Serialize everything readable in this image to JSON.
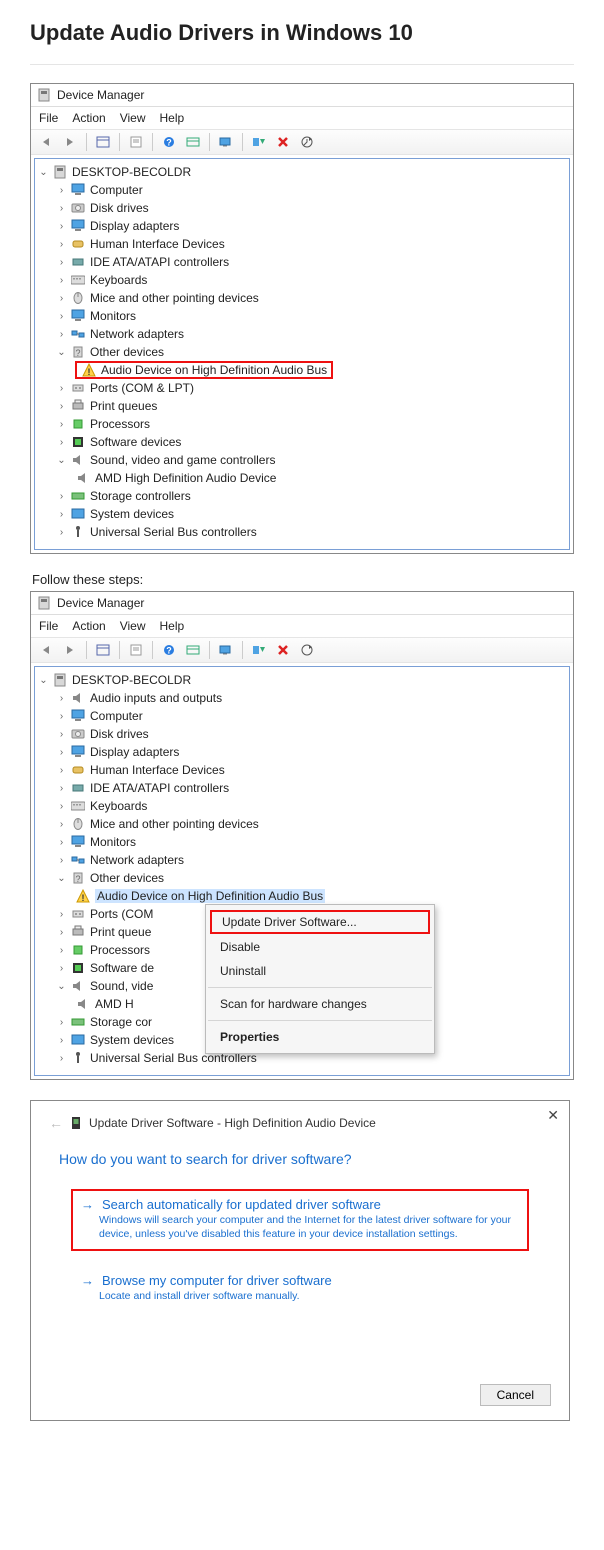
{
  "article": {
    "title": "Update Audio Drivers in Windows 10",
    "follow_steps": "Follow these steps:"
  },
  "dm": {
    "window_title": "Device Manager",
    "menus": [
      "File",
      "Action",
      "View",
      "Help"
    ],
    "root": "DESKTOP-BECOLDR",
    "categories_win1": [
      {
        "label": "Computer",
        "icon": "monitor"
      },
      {
        "label": "Disk drives",
        "icon": "disk"
      },
      {
        "label": "Display adapters",
        "icon": "monitor"
      },
      {
        "label": "Human Interface Devices",
        "icon": "hid"
      },
      {
        "label": "IDE ATA/ATAPI controllers",
        "icon": "ide"
      },
      {
        "label": "Keyboards",
        "icon": "keyboard"
      },
      {
        "label": "Mice and other pointing devices",
        "icon": "mouse"
      },
      {
        "label": "Monitors",
        "icon": "monitor"
      },
      {
        "label": "Network adapters",
        "icon": "net"
      }
    ],
    "other_devices_label": "Other devices",
    "other_devices_item": "Audio Device on High Definition Audio Bus",
    "after_other_win1": [
      {
        "label": "Ports (COM & LPT)",
        "icon": "port"
      },
      {
        "label": "Print queues",
        "icon": "printer"
      },
      {
        "label": "Processors",
        "icon": "cpu"
      },
      {
        "label": "Software devices",
        "icon": "sw"
      }
    ],
    "sound_label": "Sound, video and game controllers",
    "sound_child": "AMD High Definition Audio Device",
    "tail_win1": [
      {
        "label": "Storage controllers",
        "icon": "storage"
      },
      {
        "label": "System devices",
        "icon": "sys"
      },
      {
        "label": "Universal Serial Bus controllers",
        "icon": "usb"
      }
    ],
    "categories_win2_pre": [
      {
        "label": "Audio inputs and outputs",
        "icon": "speaker"
      },
      {
        "label": "Computer",
        "icon": "monitor"
      },
      {
        "label": "Disk drives",
        "icon": "disk"
      },
      {
        "label": "Display adapters",
        "icon": "monitor"
      },
      {
        "label": "Human Interface Devices",
        "icon": "hid"
      },
      {
        "label": "IDE ATA/ATAPI controllers",
        "icon": "ide"
      },
      {
        "label": "Keyboards",
        "icon": "keyboard"
      },
      {
        "label": "Mice and other pointing devices",
        "icon": "mouse"
      },
      {
        "label": "Monitors",
        "icon": "monitor"
      },
      {
        "label": "Network adapters",
        "icon": "net"
      }
    ],
    "after_other_win2": [
      {
        "label": "Ports (COM",
        "icon": "port"
      },
      {
        "label": "Print queue",
        "icon": "printer"
      },
      {
        "label": "Processors",
        "icon": "cpu"
      },
      {
        "label": "Software de",
        "icon": "sw"
      }
    ],
    "sound_label_trunc": "Sound, vide",
    "sound_child_trunc": "AMD H",
    "storage_trunc": "Storage cor",
    "tail_win2": [
      {
        "label": "System devices",
        "icon": "sys"
      },
      {
        "label": "Universal Serial Bus controllers",
        "icon": "usb"
      }
    ]
  },
  "context_menu": {
    "items": [
      {
        "label": "Update Driver Software...",
        "highlight": true
      },
      {
        "label": "Disable"
      },
      {
        "label": "Uninstall"
      },
      {
        "sep": true
      },
      {
        "label": "Scan for hardware changes"
      },
      {
        "sep": true
      },
      {
        "label": "Properties",
        "bold": true
      }
    ]
  },
  "wizard": {
    "title": "Update Driver Software - High Definition Audio Device",
    "question": "How do you want to search for driver software?",
    "opt1_title": "Search automatically for updated driver software",
    "opt1_desc": "Windows will search your computer and the Internet for the latest driver software for your device, unless you've disabled this feature in your device installation settings.",
    "opt2_title": "Browse my computer for driver software",
    "opt2_desc": "Locate and install driver software manually.",
    "cancel": "Cancel"
  }
}
